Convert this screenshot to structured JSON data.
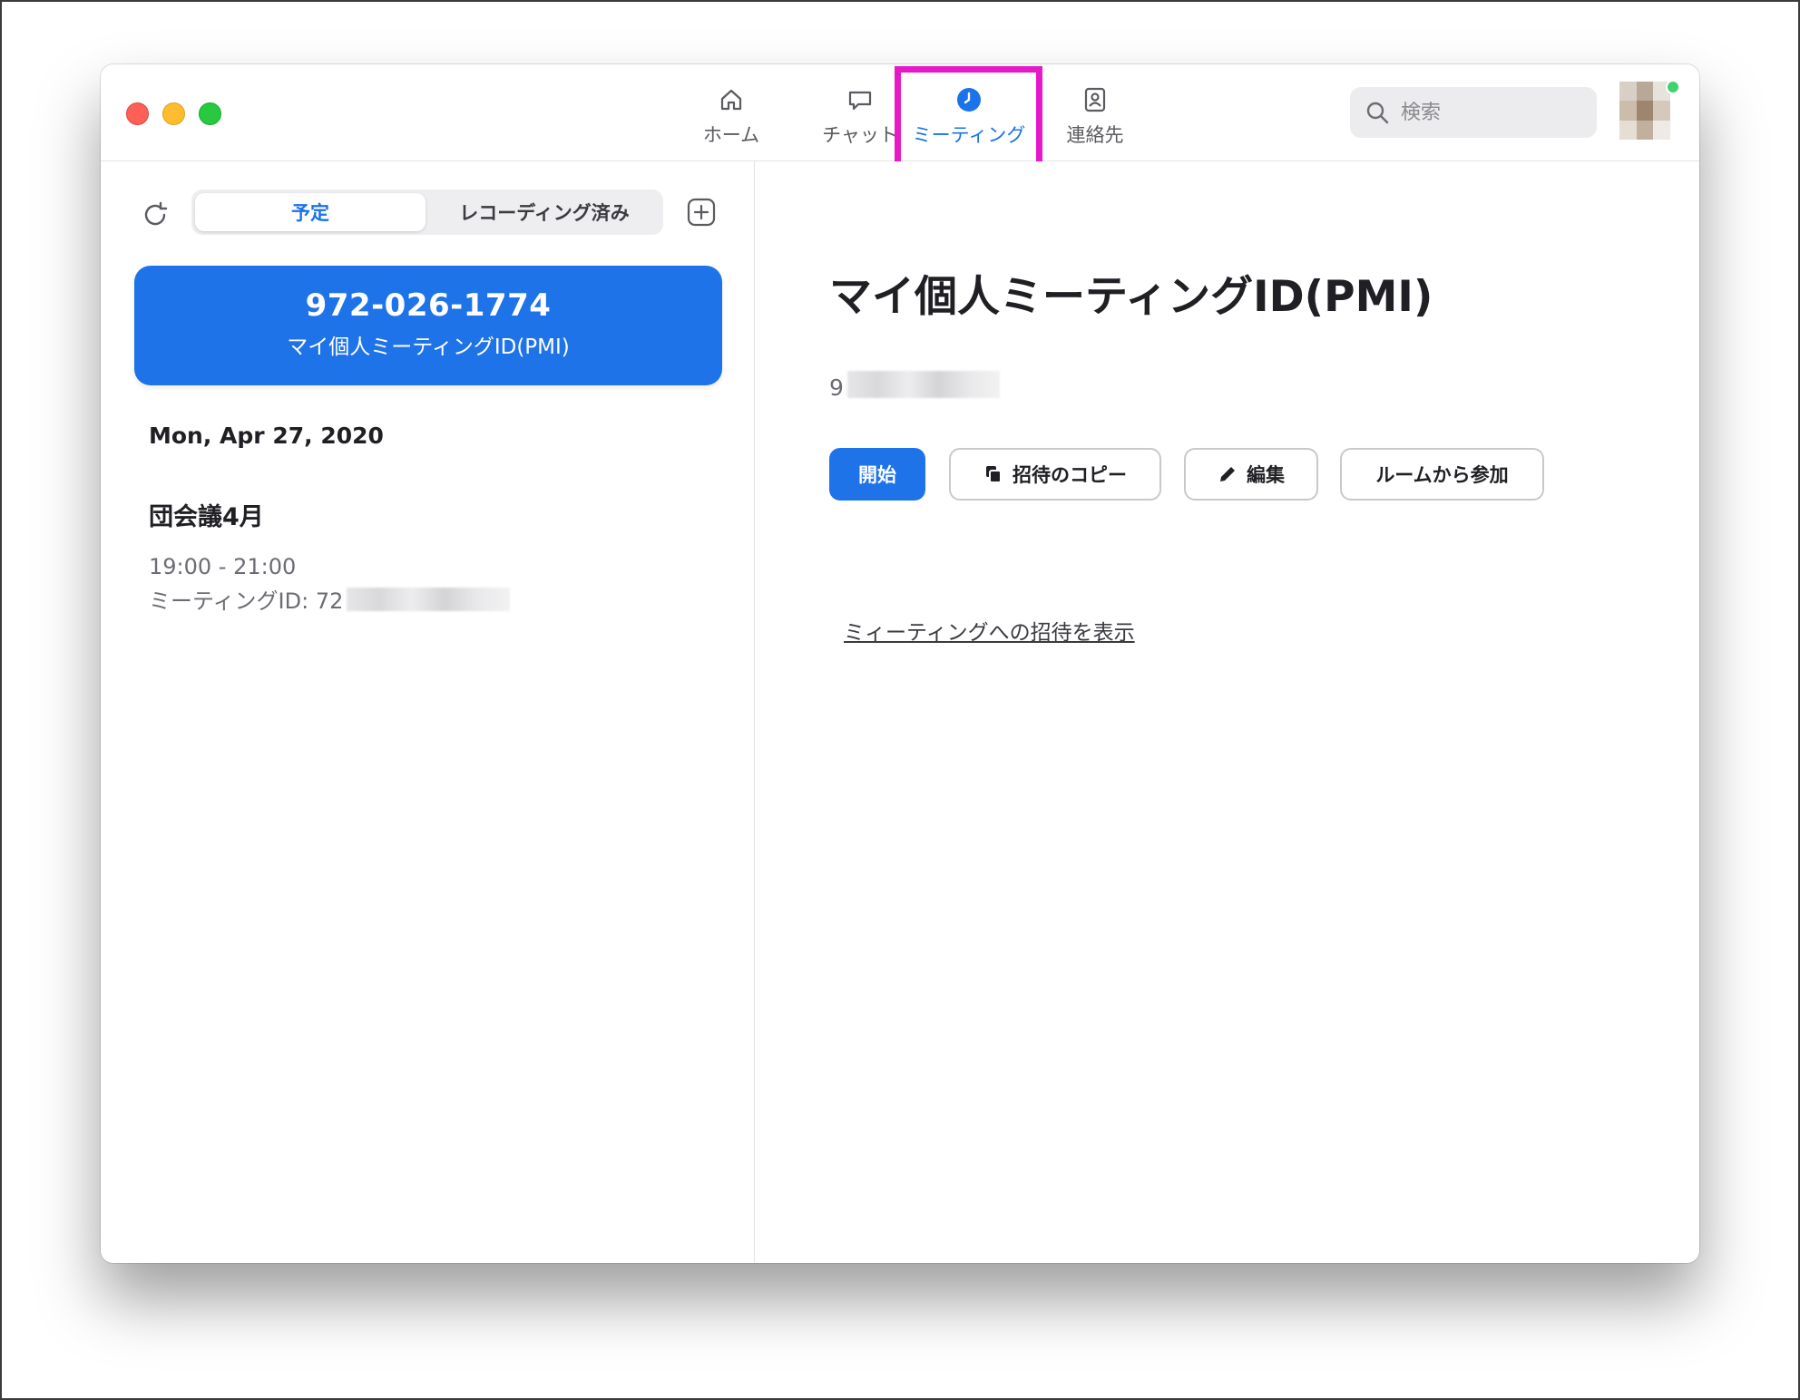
{
  "nav": {
    "tabs": [
      {
        "label": "ホーム",
        "icon": "home-icon"
      },
      {
        "label": "チャット",
        "icon": "chat-bubble-icon"
      },
      {
        "label": "ミーティング",
        "icon": "clock-icon",
        "active": true
      },
      {
        "label": "連絡先",
        "icon": "contact-icon"
      }
    ]
  },
  "search": {
    "placeholder": "検索"
  },
  "colors": {
    "accent": "#1e73e8",
    "highlight": "#e619c8",
    "status_online": "#3fd46b"
  },
  "left": {
    "segments": {
      "scheduled": "予定",
      "recorded": "レコーディング済み"
    },
    "pmi_card": {
      "number": "972-026-1774",
      "label": "マイ個人ミーティングID(PMI)"
    },
    "date_heading": "Mon, Apr 27, 2020",
    "meetings": [
      {
        "title": "団会議4月",
        "time": "19:00 - 21:00",
        "id_prefix": "ミーティングID: 72"
      }
    ]
  },
  "detail": {
    "title": "マイ個人ミーティングID(PMI)",
    "id_prefix": "9",
    "buttons": {
      "start": "開始",
      "copy_invite": "招待のコピー",
      "edit": "編集",
      "join_from_room": "ルームから参加"
    },
    "invite_link": "ミィーティングへの招待を表示"
  }
}
